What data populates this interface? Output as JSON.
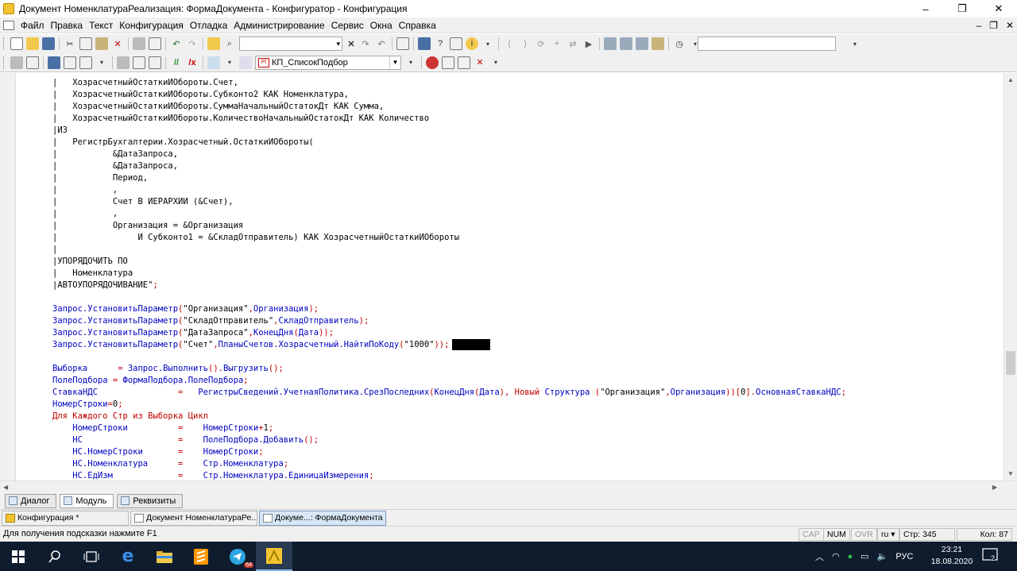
{
  "window": {
    "title": "Документ НоменклатураРеализация: ФормаДокумента - Конфигуратор - Конфигурация",
    "controls": [
      "–",
      "❐",
      "✕"
    ]
  },
  "menu": {
    "items": [
      "Файл",
      "Правка",
      "Текст",
      "Конфигурация",
      "Отладка",
      "Администрирование",
      "Сервис",
      "Окна",
      "Справка"
    ],
    "mdi_controls": [
      "–",
      "❐",
      "✕"
    ]
  },
  "toolbar2": {
    "procedure_combo": "КП_СписокПодбор",
    "procedure_icon": "Pl"
  },
  "code": {
    "lines": [
      [
        {
          "t": "|   ХозрасчетныйОстаткиИОбороты.Счет,",
          "c": "qtext"
        }
      ],
      [
        {
          "t": "|   ХозрасчетныйОстаткиИОбороты.Субконто2 КАК Номенклатура,",
          "c": "qtext"
        }
      ],
      [
        {
          "t": "|   ХозрасчетныйОстаткиИОбороты.СуммаНачальныйОстатокДт КАК Сумма,",
          "c": "qtext"
        }
      ],
      [
        {
          "t": "|   ХозрасчетныйОстаткиИОбороты.КоличествоНачальныйОстатокДт КАК Количество",
          "c": "qtext"
        }
      ],
      [
        {
          "t": "|ИЗ",
          "c": "qtext"
        }
      ],
      [
        {
          "t": "|   РегистрБухгалтерии.Хозрасчетный.ОстаткиИОбороты(",
          "c": "qtext"
        }
      ],
      [
        {
          "t": "|           &ДатаЗапроса,",
          "c": "qtext"
        }
      ],
      [
        {
          "t": "|           &ДатаЗапроса,",
          "c": "qtext"
        }
      ],
      [
        {
          "t": "|           Период,",
          "c": "qtext"
        }
      ],
      [
        {
          "t": "|           ,",
          "c": "qtext"
        }
      ],
      [
        {
          "t": "|           Счет В ИЕРАРХИИ (&Счет),",
          "c": "qtext"
        }
      ],
      [
        {
          "t": "|           ,",
          "c": "qtext"
        }
      ],
      [
        {
          "t": "|           Организация = &Организация",
          "c": "qtext"
        }
      ],
      [
        {
          "t": "|                И Субконто1 = &СкладОтправитель) КАК ХозрасчетныйОстаткиИОбороты",
          "c": "qtext"
        }
      ],
      [
        {
          "t": "|",
          "c": "qtext"
        }
      ],
      [
        {
          "t": "|УПОРЯДОЧИТЬ ПО",
          "c": "qtext"
        }
      ],
      [
        {
          "t": "|   Номенклатура",
          "c": "qtext"
        }
      ],
      [
        {
          "t": "|АВТОУПОРЯДОЧИВАНИЕ\"",
          "c": "qtext"
        },
        {
          "t": ";",
          "c": "op"
        }
      ],
      [
        {
          "t": "",
          "c": "qtext"
        }
      ],
      [
        {
          "t": "Запрос.УстановитьПараметр",
          "c": "id"
        },
        {
          "t": "(",
          "c": "op"
        },
        {
          "t": "\"Организация\"",
          "c": "str"
        },
        {
          "t": ",",
          "c": "op"
        },
        {
          "t": "Организация",
          "c": "id"
        },
        {
          "t": ");",
          "c": "op"
        }
      ],
      [
        {
          "t": "Запрос.УстановитьПараметр",
          "c": "id"
        },
        {
          "t": "(",
          "c": "op"
        },
        {
          "t": "\"СкладОтправитель\"",
          "c": "str"
        },
        {
          "t": ",",
          "c": "op"
        },
        {
          "t": "СкладОтправитель",
          "c": "id"
        },
        {
          "t": ");",
          "c": "op"
        }
      ],
      [
        {
          "t": "Запрос.УстановитьПараметр",
          "c": "id"
        },
        {
          "t": "(",
          "c": "op"
        },
        {
          "t": "\"ДатаЗапроса\"",
          "c": "str"
        },
        {
          "t": ",",
          "c": "op"
        },
        {
          "t": "КонецДня",
          "c": "id"
        },
        {
          "t": "(",
          "c": "op"
        },
        {
          "t": "Дата",
          "c": "id"
        },
        {
          "t": "));",
          "c": "op"
        }
      ],
      [
        {
          "t": "Запрос.УстановитьПараметр",
          "c": "id"
        },
        {
          "t": "(",
          "c": "op"
        },
        {
          "t": "\"Счет\"",
          "c": "str"
        },
        {
          "t": ",",
          "c": "op"
        },
        {
          "t": "ПланыСчетов.Хозрасчетный.НайтиПоКоду",
          "c": "id"
        },
        {
          "t": "(",
          "c": "op"
        },
        {
          "t": "\"1000\"",
          "c": "str"
        },
        {
          "t": "));",
          "c": "op"
        },
        {
          "t": "",
          "c": "redact"
        }
      ],
      [
        {
          "t": "",
          "c": "qtext"
        }
      ],
      [
        {
          "t": "Выборка      ",
          "c": "id"
        },
        {
          "t": "= ",
          "c": "op"
        },
        {
          "t": "Запрос.Выполнить",
          "c": "id"
        },
        {
          "t": "().",
          "c": "op"
        },
        {
          "t": "Выгрузить",
          "c": "id"
        },
        {
          "t": "();",
          "c": "op"
        }
      ],
      [
        {
          "t": "ПолеПодбора ",
          "c": "id"
        },
        {
          "t": "= ",
          "c": "op"
        },
        {
          "t": "ФормаПодбора.ПолеПодбора",
          "c": "id"
        },
        {
          "t": ";",
          "c": "op"
        }
      ],
      [
        {
          "t": "СтавкаНДС                ",
          "c": "id"
        },
        {
          "t": "=   ",
          "c": "op"
        },
        {
          "t": "РегистрыСведений.УчетнаяПолитика.СрезПоследних",
          "c": "id"
        },
        {
          "t": "(",
          "c": "op"
        },
        {
          "t": "КонецДня",
          "c": "id"
        },
        {
          "t": "(",
          "c": "op"
        },
        {
          "t": "Дата",
          "c": "id"
        },
        {
          "t": "), ",
          "c": "op"
        },
        {
          "t": "Новый ",
          "c": "kw"
        },
        {
          "t": "Структура ",
          "c": "id"
        },
        {
          "t": "(",
          "c": "op"
        },
        {
          "t": "\"Организация\"",
          "c": "str"
        },
        {
          "t": ",",
          "c": "op"
        },
        {
          "t": "Организация",
          "c": "id"
        },
        {
          "t": "))[",
          "c": "op"
        },
        {
          "t": "0",
          "c": "str"
        },
        {
          "t": "].",
          "c": "op"
        },
        {
          "t": "ОсновнаяСтавкаНДС",
          "c": "id"
        },
        {
          "t": ";",
          "c": "op"
        }
      ],
      [
        {
          "t": "НомерСтроки",
          "c": "id"
        },
        {
          "t": "=",
          "c": "op"
        },
        {
          "t": "0",
          "c": "str"
        },
        {
          "t": ";",
          "c": "op"
        }
      ],
      [
        {
          "t": "Для Каждого ",
          "c": "kw"
        },
        {
          "t": "Стр ",
          "c": "kw"
        },
        {
          "t": "из ",
          "c": "kw"
        },
        {
          "t": "Выборка ",
          "c": "kw"
        },
        {
          "t": "Цикл",
          "c": "kw"
        }
      ],
      [
        {
          "t": "    НомерСтроки          ",
          "c": "id"
        },
        {
          "t": "=    ",
          "c": "op"
        },
        {
          "t": "НомерСтроки",
          "c": "id"
        },
        {
          "t": "+",
          "c": "op"
        },
        {
          "t": "1",
          "c": "str"
        },
        {
          "t": ";",
          "c": "op"
        }
      ],
      [
        {
          "t": "    НС                   ",
          "c": "id"
        },
        {
          "t": "=    ",
          "c": "op"
        },
        {
          "t": "ПолеПодбора.Добавить",
          "c": "id"
        },
        {
          "t": "();",
          "c": "op"
        }
      ],
      [
        {
          "t": "    НС.НомерСтроки       ",
          "c": "id"
        },
        {
          "t": "=    ",
          "c": "op"
        },
        {
          "t": "НомерСтроки",
          "c": "id"
        },
        {
          "t": ";",
          "c": "op"
        }
      ],
      [
        {
          "t": "    НС.Номенклатура      ",
          "c": "id"
        },
        {
          "t": "=    ",
          "c": "op"
        },
        {
          "t": "Стр.Номенклатура",
          "c": "id"
        },
        {
          "t": ";",
          "c": "op"
        }
      ],
      [
        {
          "t": "    НС.ЕдИзм             ",
          "c": "id"
        },
        {
          "t": "=    ",
          "c": "op"
        },
        {
          "t": "Стр.Номенклатура.ЕдиницаИзмерения",
          "c": "id"
        },
        {
          "t": ";",
          "c": "op"
        }
      ]
    ]
  },
  "bottom_tabs": {
    "dialog": "Диалог",
    "module": "Модуль",
    "requisites": "Реквизиты"
  },
  "window_list": {
    "config": "Конфигурация *",
    "doc": "Документ НоменклатураРе...",
    "form": "Докуме...: ФормаДокумента"
  },
  "status": {
    "hint": "Для получения подсказки нажмите F1",
    "cap": "CAP",
    "num": "NUM",
    "ovr": "OVR",
    "lang": "ru",
    "row": "Стр: 345",
    "col": "Кол: 87"
  },
  "taskbar": {
    "lang": "РУС",
    "time": "23:21",
    "date": "18.08.2020",
    "telegram_badge": "64",
    "notif_count": "2"
  }
}
